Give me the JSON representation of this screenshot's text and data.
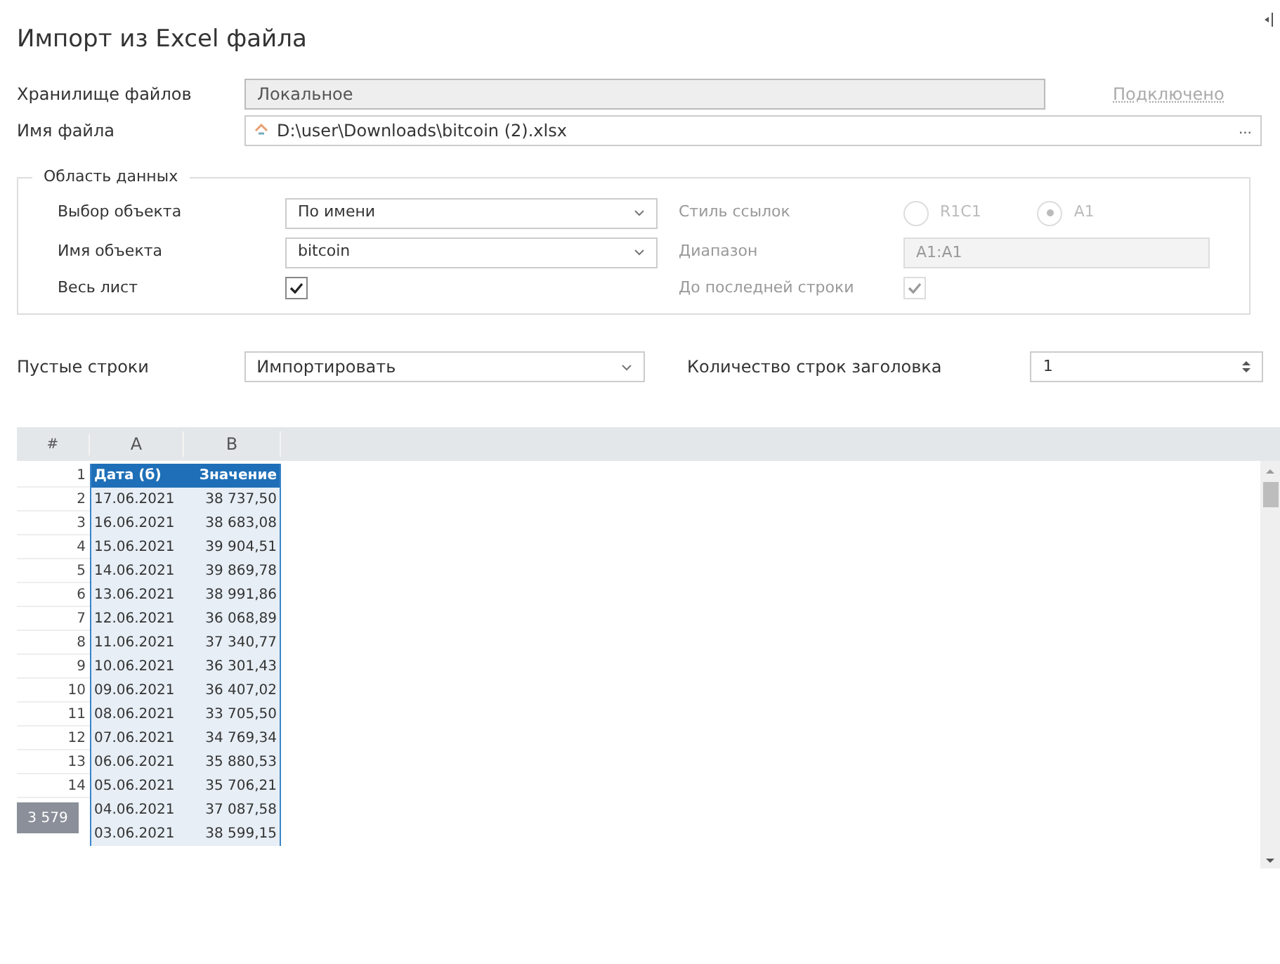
{
  "title": "Импорт из Excel файла",
  "storage": {
    "label": "Хранилище файлов",
    "value": "Локальное",
    "status": "Подключено"
  },
  "file": {
    "label": "Имя файла",
    "value": "D:\\user\\Downloads\\bitcoin (2).xlsx",
    "browse": "..."
  },
  "data_area": {
    "legend": "Область данных",
    "object_choice": {
      "label": "Выбор объекта",
      "value": "По имени"
    },
    "object_name": {
      "label": "Имя объекта",
      "value": "bitcoin"
    },
    "whole_sheet": {
      "label": "Весь лист",
      "checked": true
    },
    "ref_style": {
      "label": "Стиль ссылок",
      "disabled": true,
      "options": [
        {
          "label": "R1C1",
          "selected": false
        },
        {
          "label": "A1",
          "selected": true
        }
      ]
    },
    "range": {
      "label": "Диапазон",
      "value": "A1:A1",
      "disabled": true
    },
    "to_last_row": {
      "label": "До последней строки",
      "checked": true,
      "disabled": true
    }
  },
  "empty_rows": {
    "label": "Пустые строки",
    "value": "Импортировать"
  },
  "header_rows": {
    "label": "Количество строк заголовка",
    "value": "1"
  },
  "grid": {
    "number_header": "#",
    "columns": [
      "A",
      "B"
    ],
    "row_count_badge": "3 579",
    "rows": [
      {
        "num": "1",
        "cells": [
          "Дата (б)",
          "Значение"
        ],
        "header": true
      },
      {
        "num": "2",
        "cells": [
          "17.06.2021",
          "38 737,50"
        ]
      },
      {
        "num": "3",
        "cells": [
          "16.06.2021",
          "38 683,08"
        ]
      },
      {
        "num": "4",
        "cells": [
          "15.06.2021",
          "39 904,51"
        ]
      },
      {
        "num": "5",
        "cells": [
          "14.06.2021",
          "39 869,78"
        ]
      },
      {
        "num": "6",
        "cells": [
          "13.06.2021",
          "38 991,86"
        ]
      },
      {
        "num": "7",
        "cells": [
          "12.06.2021",
          "36 068,89"
        ]
      },
      {
        "num": "8",
        "cells": [
          "11.06.2021",
          "37 340,77"
        ]
      },
      {
        "num": "9",
        "cells": [
          "10.06.2021",
          "36 301,43"
        ]
      },
      {
        "num": "10",
        "cells": [
          "09.06.2021",
          "36 407,02"
        ]
      },
      {
        "num": "11",
        "cells": [
          "08.06.2021",
          "33 705,50"
        ]
      },
      {
        "num": "12",
        "cells": [
          "07.06.2021",
          "34 769,34"
        ]
      },
      {
        "num": "13",
        "cells": [
          "06.06.2021",
          "35 880,53"
        ]
      },
      {
        "num": "14",
        "cells": [
          "05.06.2021",
          "35 706,21"
        ]
      },
      {
        "cells": [
          "04.06.2021",
          "37 087,58"
        ]
      },
      {
        "cells": [
          "03.06.2021",
          "38 599,15"
        ]
      }
    ]
  }
}
